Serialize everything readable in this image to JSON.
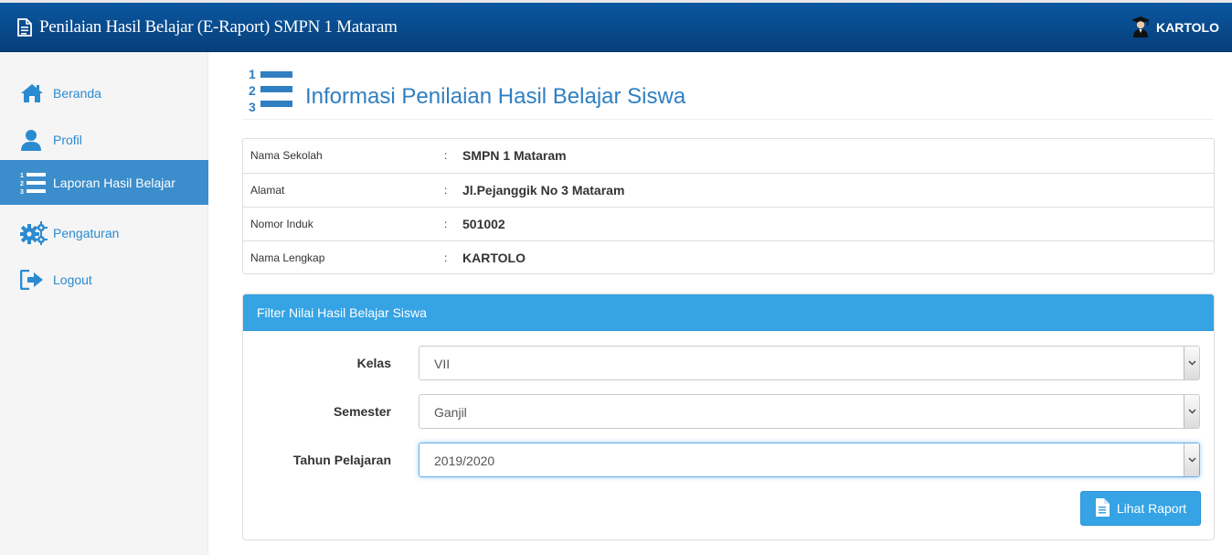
{
  "header": {
    "app_title": "Penilaian Hasil Belajar (E-Raport) SMPN 1 Mataram",
    "user_name": "KARTOLO"
  },
  "sidebar": {
    "items": [
      {
        "label": "Beranda",
        "icon": "home-icon"
      },
      {
        "label": "Profil",
        "icon": "user-icon"
      },
      {
        "label": "Laporan Hasil Belajar",
        "icon": "ordered-list-icon",
        "active": true
      },
      {
        "label": "Pengaturan",
        "icon": "gears-icon"
      },
      {
        "label": "Logout",
        "icon": "logout-icon"
      }
    ]
  },
  "page": {
    "title": "Informasi Penilaian Hasil Belajar Siswa"
  },
  "info": {
    "rows": [
      {
        "key": "Nama Sekolah",
        "sep": ":",
        "value": "SMPN 1 Mataram"
      },
      {
        "key": "Alamat",
        "sep": ":",
        "value": "Jl.Pejanggik No 3 Mataram"
      },
      {
        "key": "Nomor Induk",
        "sep": ":",
        "value": "501002"
      },
      {
        "key": "Nama Lengkap",
        "sep": ":",
        "value": "KARTOLO"
      }
    ]
  },
  "filter": {
    "heading": "Filter Nilai Hasil Belajar Siswa",
    "fields": [
      {
        "label": "Kelas",
        "value": "VII"
      },
      {
        "label": "Semester",
        "value": "Ganjil"
      },
      {
        "label": "Tahun Pelajaran",
        "value": "2019/2020"
      }
    ],
    "submit_label": "Lihat Raport"
  },
  "colors": {
    "navbar": "#0a57a0",
    "accent": "#35a3e4",
    "sidebar_active": "#3c8dcc",
    "link": "#2a8bd0"
  }
}
